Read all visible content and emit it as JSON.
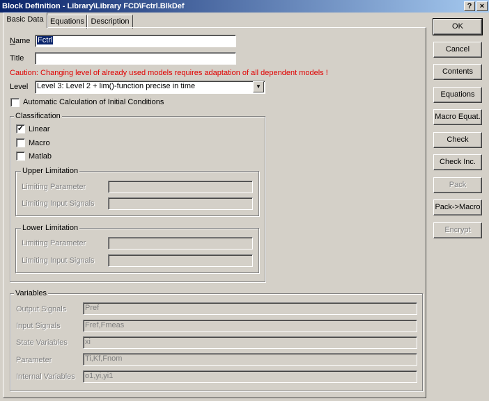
{
  "window": {
    "title": "Block Definition - Library\\Library FCD\\Fctrl.BlkDef",
    "help_btn": "?",
    "close_btn": "×"
  },
  "tabs": [
    {
      "label": "Basic Data"
    },
    {
      "label": "Equations"
    },
    {
      "label": "Description"
    }
  ],
  "form": {
    "name_label": "Name",
    "name_value": "Fctrl",
    "title_label": "Title",
    "title_value": "",
    "caution": "Caution: Changing level of already used models requires adaptation of all dependent models !",
    "level_label": "Level",
    "level_value": "Level 3: Level 2 + lim()-function precise in time",
    "auto_calc_label": "Automatic Calculation of Initial Conditions"
  },
  "classification": {
    "title": "Classification",
    "linear_label": "Linear",
    "macro_label": "Macro",
    "matlab_label": "Matlab",
    "check_mark": "✓",
    "upper": {
      "title": "Upper Limitation",
      "param_label": "Limiting Parameter",
      "signals_label": "Limiting Input Signals"
    },
    "lower": {
      "title": "Lower Limitation",
      "param_label": "Limiting Parameter",
      "signals_label": "Limiting Input Signals"
    }
  },
  "variables": {
    "title": "Variables",
    "output_label": "Output Signals",
    "output_value": "Pref",
    "input_label": "Input Signals",
    "input_value": "Fref,Fmeas",
    "state_label": "State Variables",
    "state_value": "xi",
    "param_label": "Parameter",
    "param_value": "Ti,Kf,Fnom",
    "internal_label": "Internal Variables",
    "internal_value": "o1,yi,yi1"
  },
  "buttons": {
    "ok": "OK",
    "cancel": "Cancel",
    "contents": "Contents",
    "equations": "Equations",
    "macro_equat": "Macro Equat.",
    "check": "Check",
    "check_inc": "Check Inc.",
    "pack": "Pack",
    "pack_macro": "Pack->Macro",
    "encrypt": "Encrypt"
  }
}
